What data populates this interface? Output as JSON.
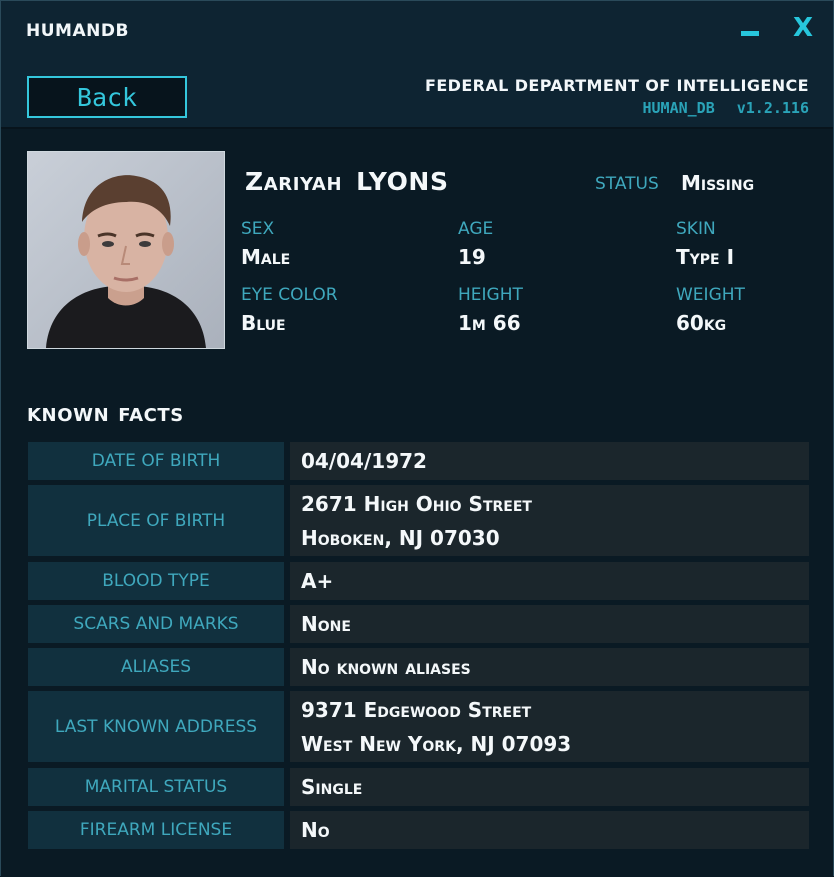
{
  "window": {
    "title": "HUMANDB",
    "minimize_icon": "minimize-icon",
    "close_icon": "close-icon",
    "close_glyph": "X"
  },
  "header": {
    "back_label": "Back",
    "organization": "FEDERAL DEPARTMENT OF INTELLIGENCE",
    "db_name": "HUMAN_DB",
    "version": "v1.2.116"
  },
  "profile": {
    "first_name": "Zariyah",
    "last_name": "LYONS",
    "status_label": "STATUS",
    "status_value": "Missing",
    "photo_icon": "person-photo",
    "attributes": [
      {
        "label": "SEX",
        "value": "Male"
      },
      {
        "label": "AGE",
        "value": "19"
      },
      {
        "label": "SKIN",
        "value": "Type I"
      },
      {
        "label": "EYE COLOR",
        "value": "Blue"
      },
      {
        "label": "HEIGHT",
        "value": "1m 66"
      },
      {
        "label": "WEIGHT",
        "value": "60kg"
      }
    ]
  },
  "facts": {
    "heading_word1": "KNOWN",
    "heading_word2": "FACTS",
    "rows": [
      {
        "label": "DATE OF BIRTH",
        "value_line1": "04/04/1972",
        "value_line2": ""
      },
      {
        "label": "PLACE OF BIRTH",
        "value_line1": "2671 High Ohio Street",
        "value_line2": "Hoboken, NJ 07030"
      },
      {
        "label": "BLOOD TYPE",
        "value_line1": "A+",
        "value_line2": ""
      },
      {
        "label": "SCARS AND MARKS",
        "value_line1": "None",
        "value_line2": ""
      },
      {
        "label": "ALIASES",
        "value_line1": "No known aliases",
        "value_line2": ""
      },
      {
        "label": "LAST KNOWN ADDRESS",
        "value_line1": "9371 Edgewood Street",
        "value_line2": "West New York, NJ 07093"
      },
      {
        "label": "MARITAL STATUS",
        "value_line1": "Single",
        "value_line2": ""
      },
      {
        "label": "FIREARM LICENSE",
        "value_line1": "No",
        "value_line2": ""
      }
    ]
  },
  "colors": {
    "accent": "#27c6dc",
    "label_text": "#3fa8bd",
    "background": "#0a1a24",
    "label_cell": "#11303e",
    "value_cell": "#1b262c"
  }
}
